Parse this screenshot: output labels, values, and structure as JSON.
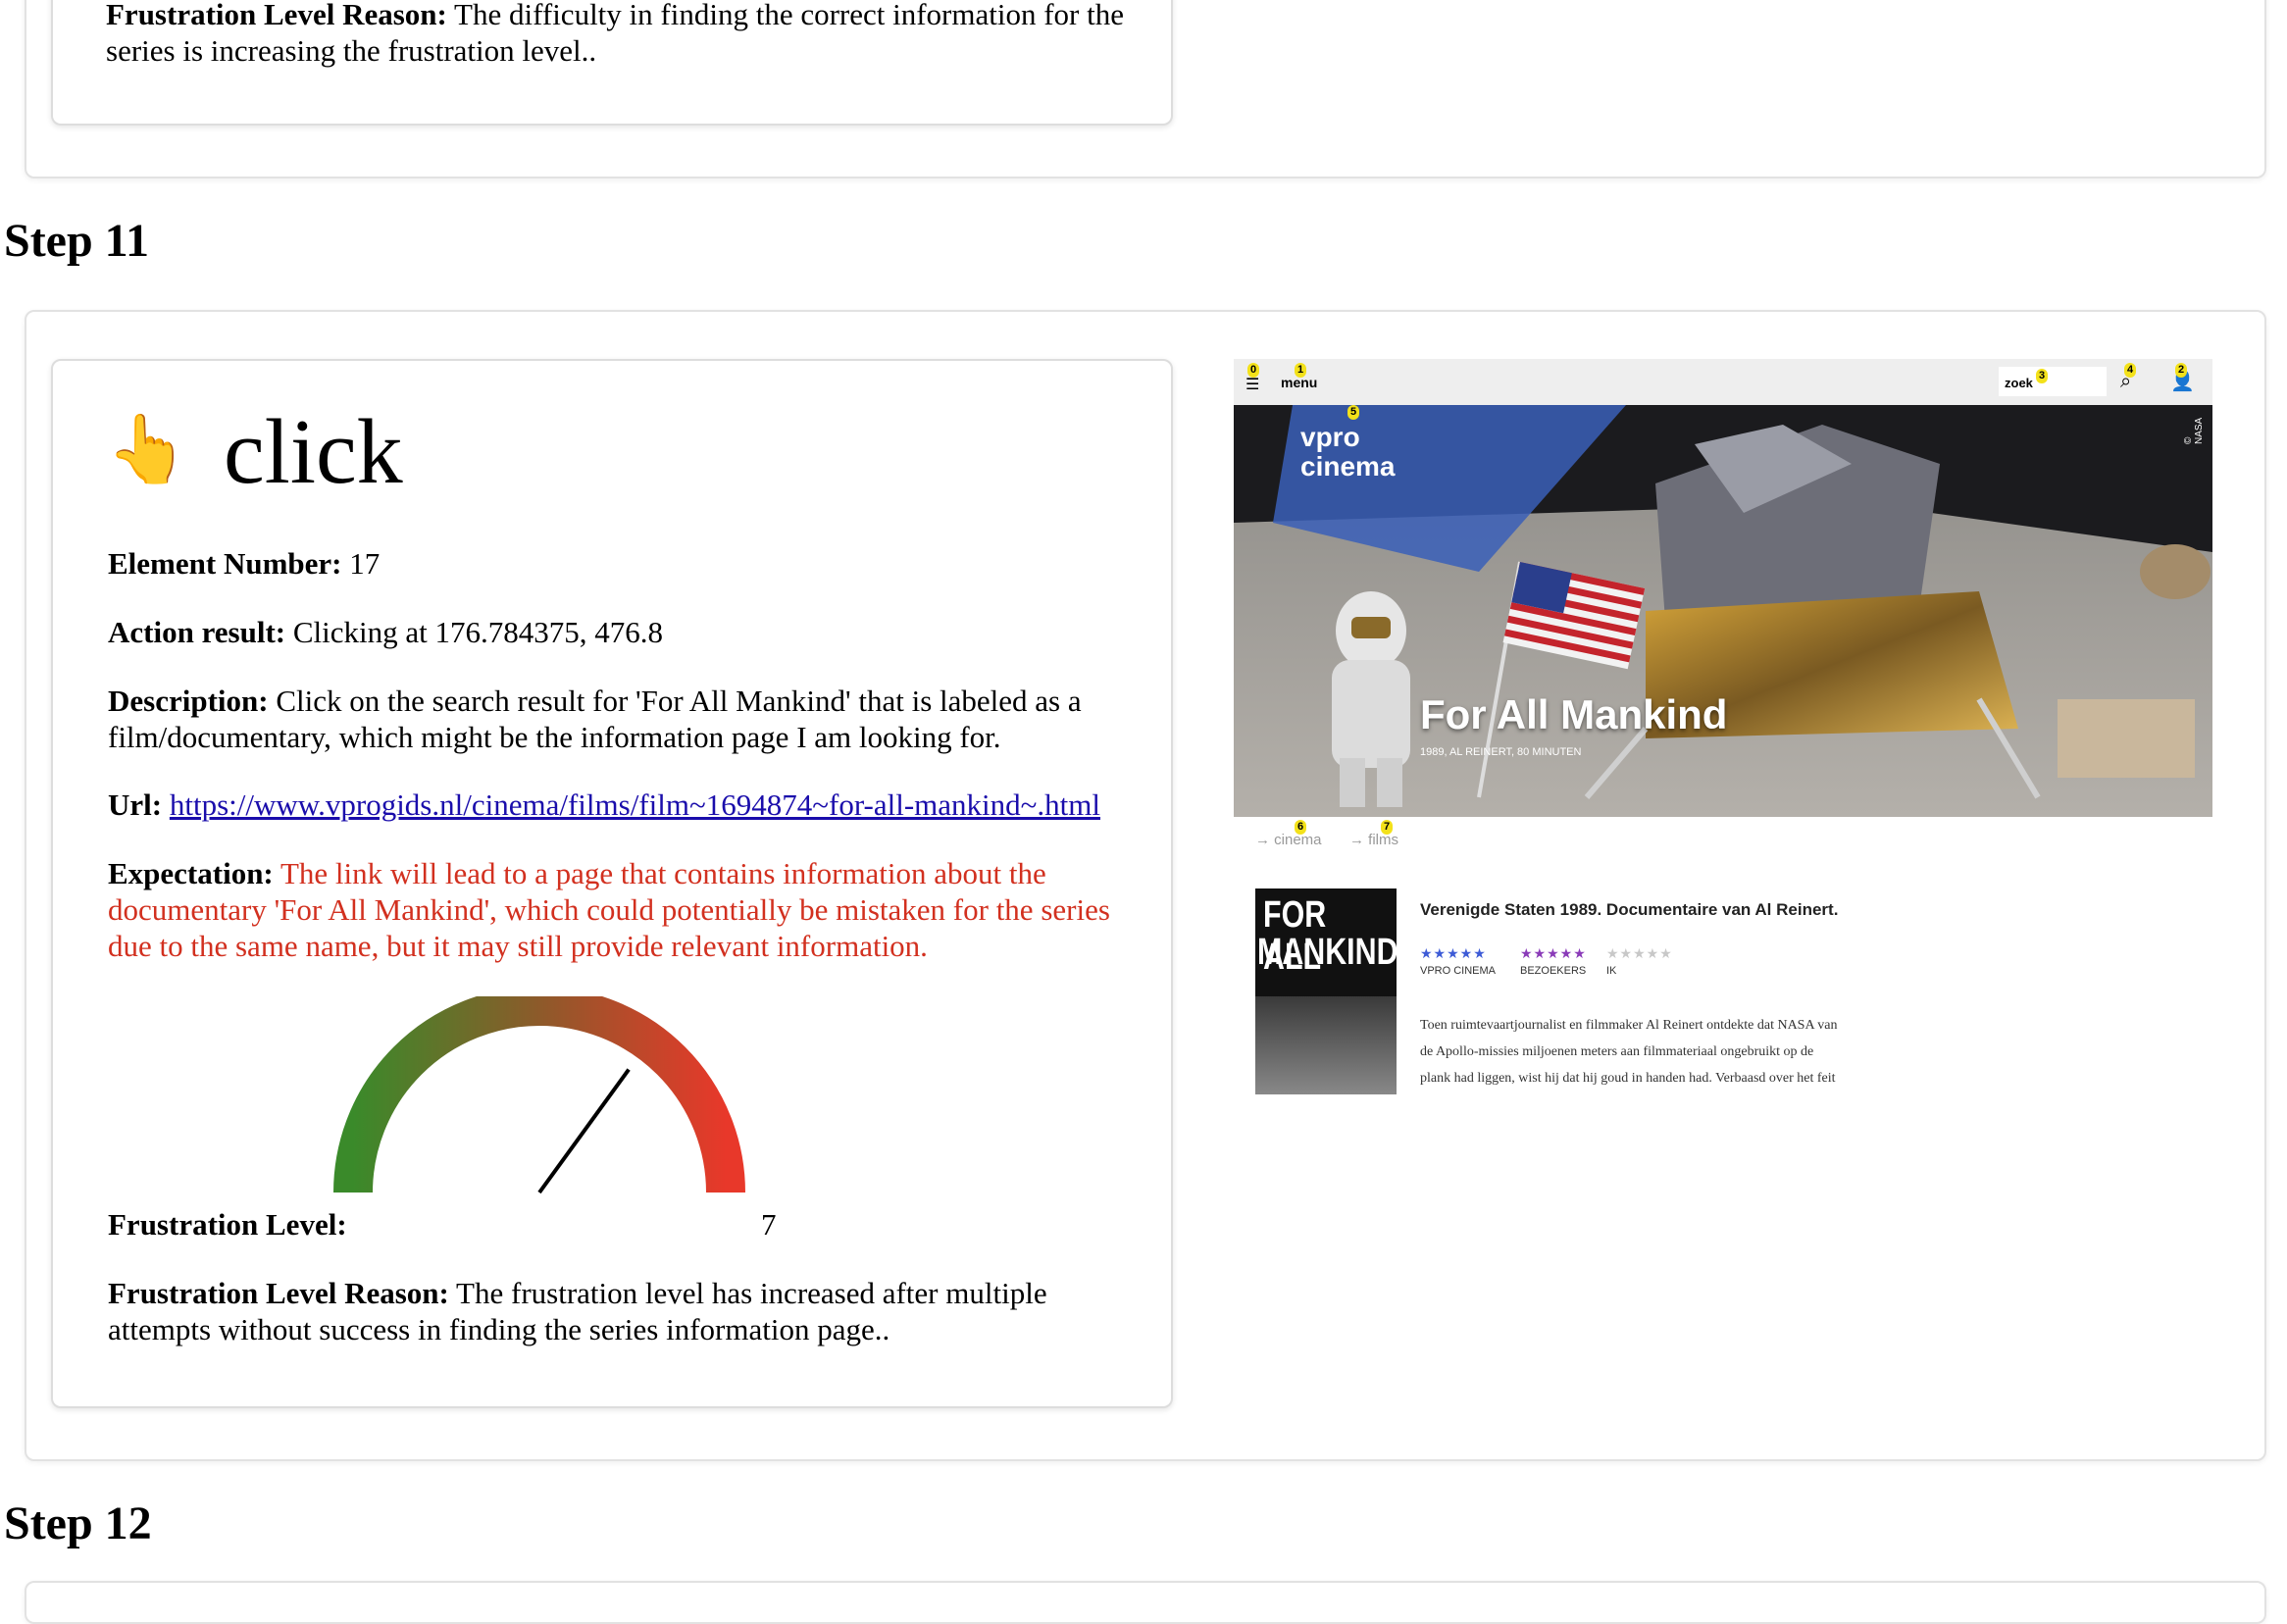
{
  "step10": {
    "frustration_reason_label": "Frustration Level Reason:",
    "frustration_reason_line1": "The difficulty in finding the correct information for the",
    "frustration_reason_line2": "series is increasing the frustration level.."
  },
  "step11": {
    "heading": "Step 11",
    "action_icon": "👆",
    "action": "click",
    "element_number_label": "Element Number:",
    "element_number": "17",
    "action_result_label": "Action result:",
    "action_result": "Clicking at 176.784375, 476.8",
    "description_label": "Description:",
    "description_line1": "Click on the search result for 'For All Mankind' that is labeled as a",
    "description_line2": "film/documentary, which might be the information page I am looking for.",
    "url_label": "Url:",
    "url": "https://www.vprogids.nl/cinema/films/film~1694874~for-all-mankind~.html",
    "expectation_label": "Expectation:",
    "expectation_line1": "The link will lead to a page that contains information about the",
    "expectation_line2": "documentary 'For All Mankind', which could potentially be mistaken for the series",
    "expectation_line3": "due to the same name, but it may still provide relevant information.",
    "frustration_level_label": "Frustration Level:",
    "frustration_level": 7,
    "frustration_level_max": 10,
    "frustration_level_text": "7",
    "frustration_reason_label": "Frustration Level Reason:",
    "frustration_reason_line1": "The frustration level has increased after multiple",
    "frustration_reason_line2": "attempts without success in finding the series information page..",
    "colors": {
      "gauge_low": "#3a8a2a",
      "gauge_mid": "#8d5a2a",
      "gauge_high": "#e8382a",
      "expectation": "#d2301f"
    }
  },
  "step12": {
    "heading": "Step 12"
  },
  "screenshot": {
    "menu_label": "menu",
    "search_label": "zoek",
    "logo_line1": "vpro",
    "logo_line2": "cinema",
    "nasa_credit": "© NASA",
    "film_title": "For All Mankind",
    "film_meta": "1989, AL REINERT, 80 MINUTEN",
    "breadcrumb_1": "→ cinema",
    "breadcrumb_2": "→ films",
    "poster_line1": "FOR ALL",
    "poster_line2": "MANKIND",
    "subtitle": "Verenigde Staten 1989. Documentaire van Al Reinert.",
    "rating_vpro_label": "VPRO CINEMA",
    "rating_visitors_label": "BEZOEKERS",
    "rating_me_label": "IK",
    "rating_vpro_stars": "★★★★★",
    "rating_visitors_stars": "★★★★★",
    "rating_me_stars": "★★★★★",
    "body_line1": "Toen ruimtevaartjournalist en filmmaker Al Reinert ontdekte dat NASA van",
    "body_line2": "de Apollo-missies miljoenen meters aan filmmateriaal ongebruikt op de",
    "body_line3": "plank had liggen, wist hij dat hij goud in handen had. Verbaasd over het feit",
    "markers": [
      "0",
      "1",
      "3",
      "4",
      "2",
      "5",
      "6",
      "7",
      "6"
    ]
  }
}
